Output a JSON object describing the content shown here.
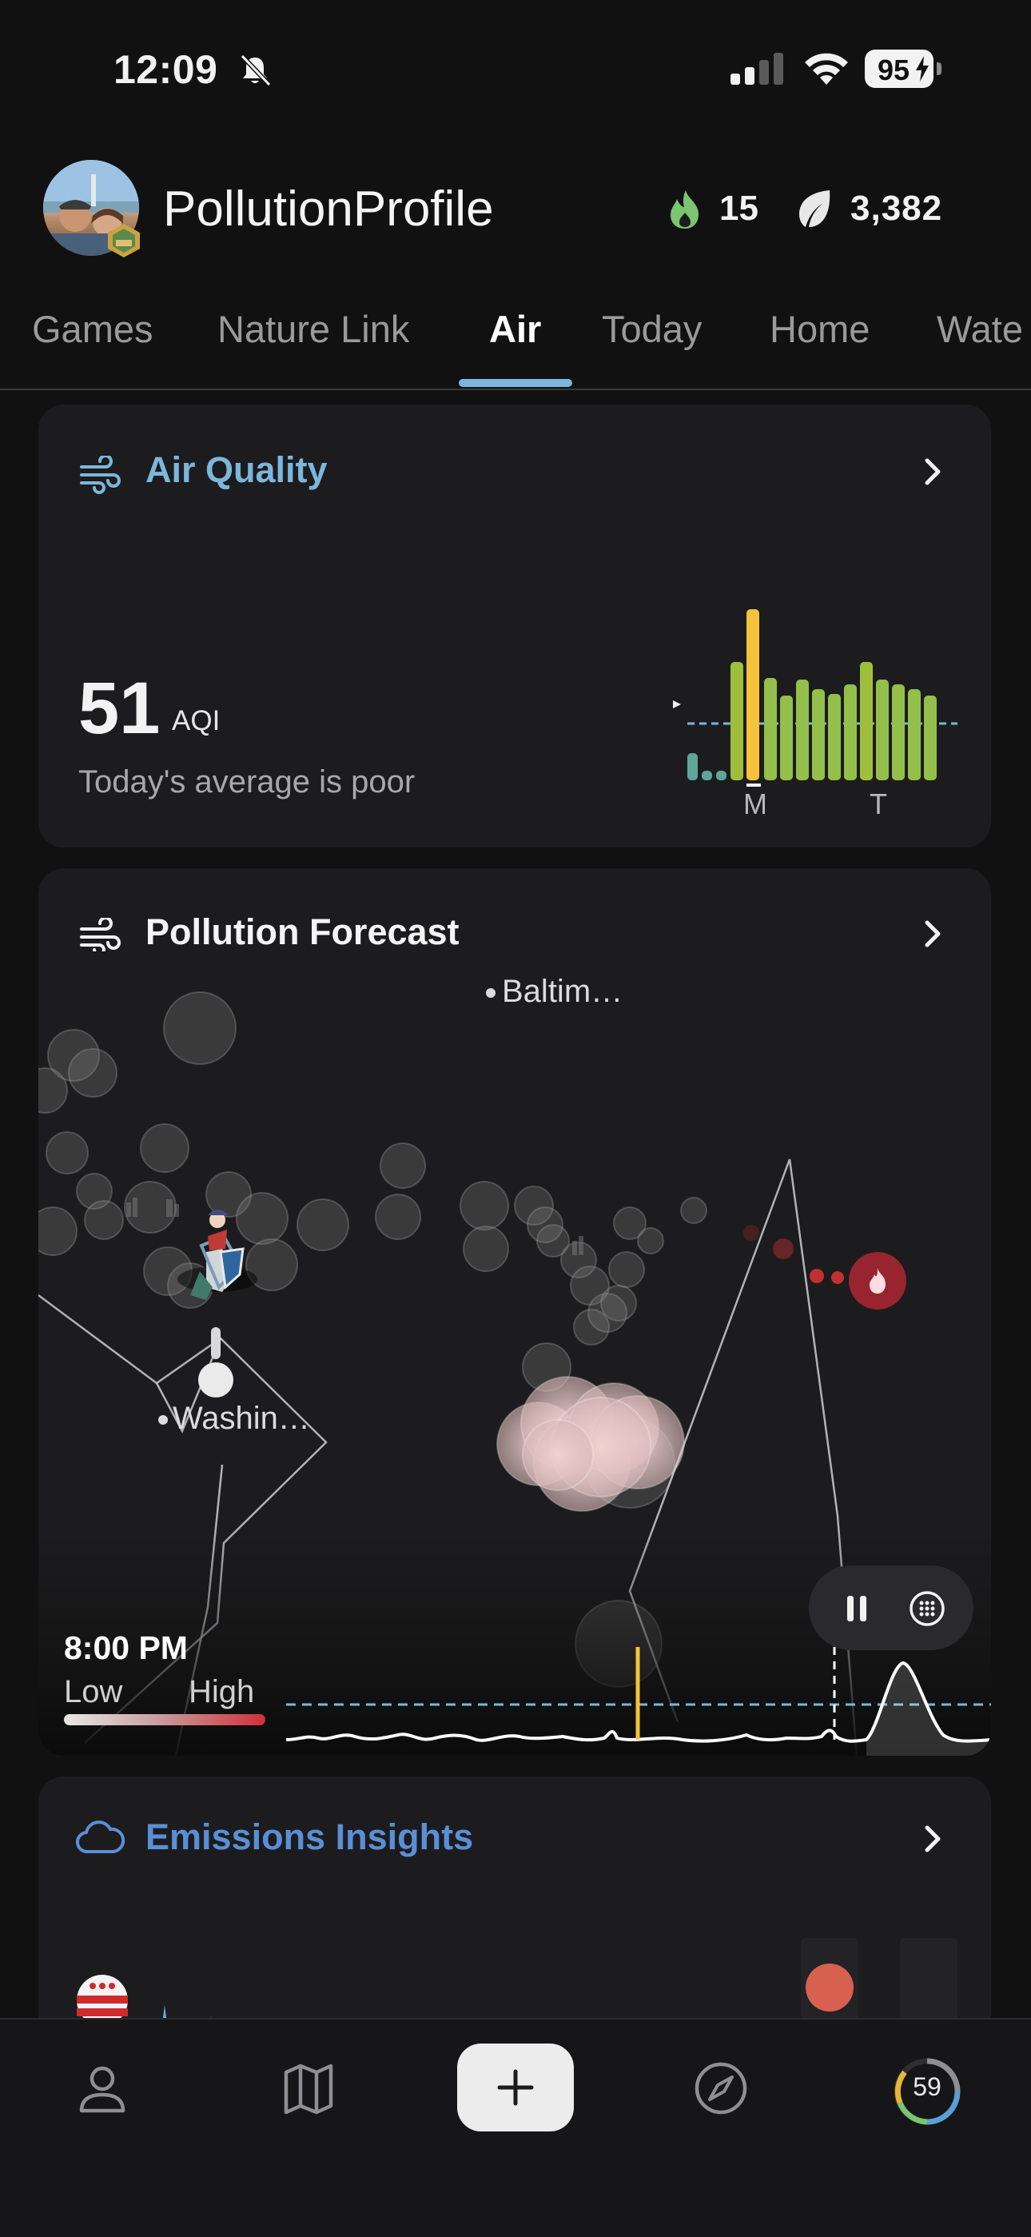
{
  "status_bar": {
    "time": "12:09",
    "battery": "95"
  },
  "header": {
    "app_title": "PollutionProfile",
    "streak_count": "15",
    "leaf_count": "3,382"
  },
  "tabs": [
    {
      "label": "Games"
    },
    {
      "label": "Nature Link"
    },
    {
      "label": "Air"
    },
    {
      "label": "Today"
    },
    {
      "label": "Home"
    },
    {
      "label": "Wate"
    }
  ],
  "air_quality": {
    "title": "Air Quality",
    "value": "51",
    "unit": "AQI",
    "subtitle": "Today's average is poor",
    "day_labels": [
      "M",
      "T"
    ]
  },
  "pollution_forecast": {
    "title": "Pollution Forecast",
    "cities": [
      "Baltim…",
      "Washin…"
    ],
    "time": "8:00 PM",
    "scale_low": "Low",
    "scale_high": "High"
  },
  "emissions": {
    "title": "Emissions Insights"
  },
  "bottom_nav": {
    "score": "59"
  },
  "colors": {
    "accent_blue": "#7cb6dc",
    "emissions_blue": "#5a8fd6",
    "aqi_yellow": "#f6c23c",
    "aqi_green": "#93bf4a"
  }
}
